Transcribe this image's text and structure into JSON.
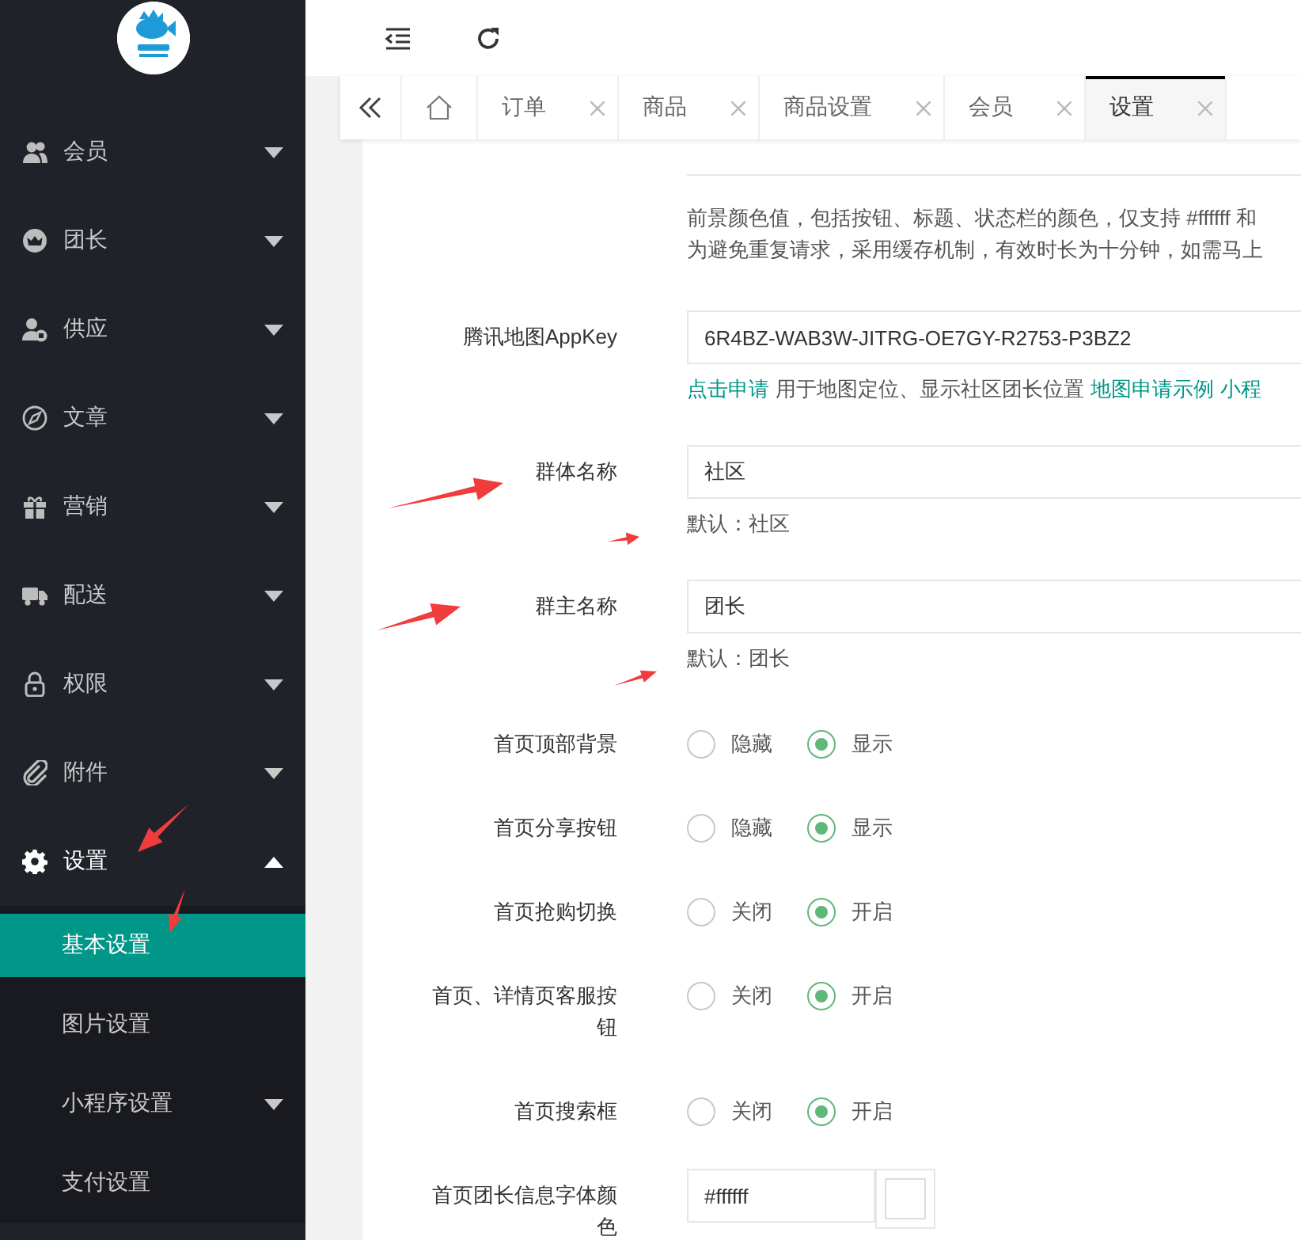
{
  "sidebar": {
    "items": [
      {
        "label": "会员",
        "expanded": false
      },
      {
        "label": "团长",
        "expanded": false
      },
      {
        "label": "供应",
        "expanded": false
      },
      {
        "label": "文章",
        "expanded": false
      },
      {
        "label": "营销",
        "expanded": false
      },
      {
        "label": "配送",
        "expanded": false
      },
      {
        "label": "权限",
        "expanded": false
      },
      {
        "label": "附件",
        "expanded": false
      },
      {
        "label": "设置",
        "expanded": true,
        "children": [
          {
            "label": "基本设置",
            "kind": "link",
            "selected": true
          },
          {
            "label": "图片设置",
            "kind": "link",
            "selected": false
          },
          {
            "label": "小程序设置",
            "kind": "group",
            "selected": false
          },
          {
            "label": "支付设置",
            "kind": "link",
            "selected": false
          }
        ]
      }
    ]
  },
  "tabs": [
    {
      "kind": "home",
      "selected": false
    },
    {
      "kind": "page",
      "label": "订单",
      "selected": false
    },
    {
      "kind": "page",
      "label": "商品",
      "selected": false
    },
    {
      "kind": "page",
      "label": "商品设置",
      "selected": false
    },
    {
      "kind": "page",
      "label": "会员",
      "selected": false
    },
    {
      "kind": "page",
      "label": "设置",
      "selected": true
    }
  ],
  "form": [
    {
      "kind": "note",
      "lines": [
        "前景颜色值，包括按钮、标题、状态栏的颜色，仅支持 #ffffff 和",
        "为避免重复请求，采用缓存机制，有效时长为十分钟，如需马上"
      ]
    },
    {
      "kind": "text",
      "label": "腾讯地图AppKey",
      "value": "6R4BZ-WAB3W-JITRG-OE7GY-R2753-P3BZ2",
      "help": [
        {
          "text": "点击申请",
          "kind": "link"
        },
        {
          "text": "用于地图定位、显示社区团长位置",
          "kind": "plain"
        },
        {
          "text": "地图申请示例",
          "kind": "link"
        },
        {
          "text": "小程",
          "kind": "link"
        }
      ]
    },
    {
      "kind": "text",
      "label": "群体名称",
      "value": "社区",
      "help": [
        {
          "text": "默认：社区",
          "kind": "plain"
        }
      ]
    },
    {
      "kind": "text",
      "label": "群主名称",
      "value": "团长",
      "help": [
        {
          "text": "默认：团长",
          "kind": "plain"
        }
      ]
    },
    {
      "kind": "radio",
      "label": "首页顶部背景",
      "options": [
        {
          "label": "隐藏",
          "selected": false
        },
        {
          "label": "显示",
          "selected": true
        }
      ]
    },
    {
      "kind": "radio",
      "label": "首页分享按钮",
      "options": [
        {
          "label": "隐藏",
          "selected": false
        },
        {
          "label": "显示",
          "selected": true
        }
      ]
    },
    {
      "kind": "radio",
      "label": "首页抢购切换",
      "options": [
        {
          "label": "关闭",
          "selected": false
        },
        {
          "label": "开启",
          "selected": true
        }
      ]
    },
    {
      "kind": "radio",
      "label": "首页、详情页客服按钮",
      "options": [
        {
          "label": "关闭",
          "selected": false
        },
        {
          "label": "开启",
          "selected": true
        }
      ]
    },
    {
      "kind": "radio",
      "label": "首页搜索框",
      "options": [
        {
          "label": "关闭",
          "selected": false
        },
        {
          "label": "开启",
          "selected": true
        }
      ]
    },
    {
      "kind": "color",
      "label": "首页团长信息字体颜色",
      "value": "#ffffff"
    }
  ]
}
